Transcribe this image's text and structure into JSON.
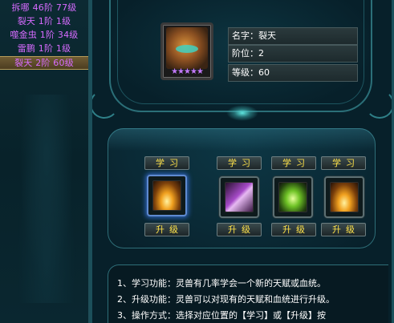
{
  "pet_list": [
    {
      "name": "拆哪",
      "stage": "46阶",
      "level": "77级",
      "selected": false
    },
    {
      "name": "裂天",
      "stage": "1阶",
      "level": "1级",
      "selected": false
    },
    {
      "name": "噬金虫",
      "stage": "1阶",
      "level": "34级",
      "selected": false
    },
    {
      "name": "雷鹏",
      "stage": "1阶",
      "level": "1级",
      "selected": false
    },
    {
      "name": "裂天",
      "stage": "2阶",
      "level": "60级",
      "selected": true
    }
  ],
  "pet_info": {
    "name_label": "名字：",
    "name_value": "裂天",
    "stage_label": "阶位：",
    "stage_value": "2",
    "level_label": "等级：",
    "level_value": "60",
    "stars": "★★★★★",
    "star_color": "#c37aff"
  },
  "skills": {
    "learn_label": "学习",
    "upgrade_label": "升级",
    "slots": [
      {
        "icon": "flame-sigil-icon",
        "active": true
      },
      {
        "icon": "purple-wing-icon",
        "active": false
      },
      {
        "icon": "green-claw-icon",
        "active": false
      },
      {
        "icon": "flame-sigil-icon",
        "active": false
      }
    ]
  },
  "description": {
    "line1": "1、学习功能：灵兽有几率学会一个新的天赋或血统。",
    "line2": "2、升级功能：灵兽可以对现有的天赋和血统进行升级。",
    "line3": "3、操作方式：选择对应位置的【学习】或【升级】按"
  },
  "colors": {
    "pet_text": "#d76bff",
    "button_text": "#ffe24a",
    "frame": "#2b6f78"
  }
}
